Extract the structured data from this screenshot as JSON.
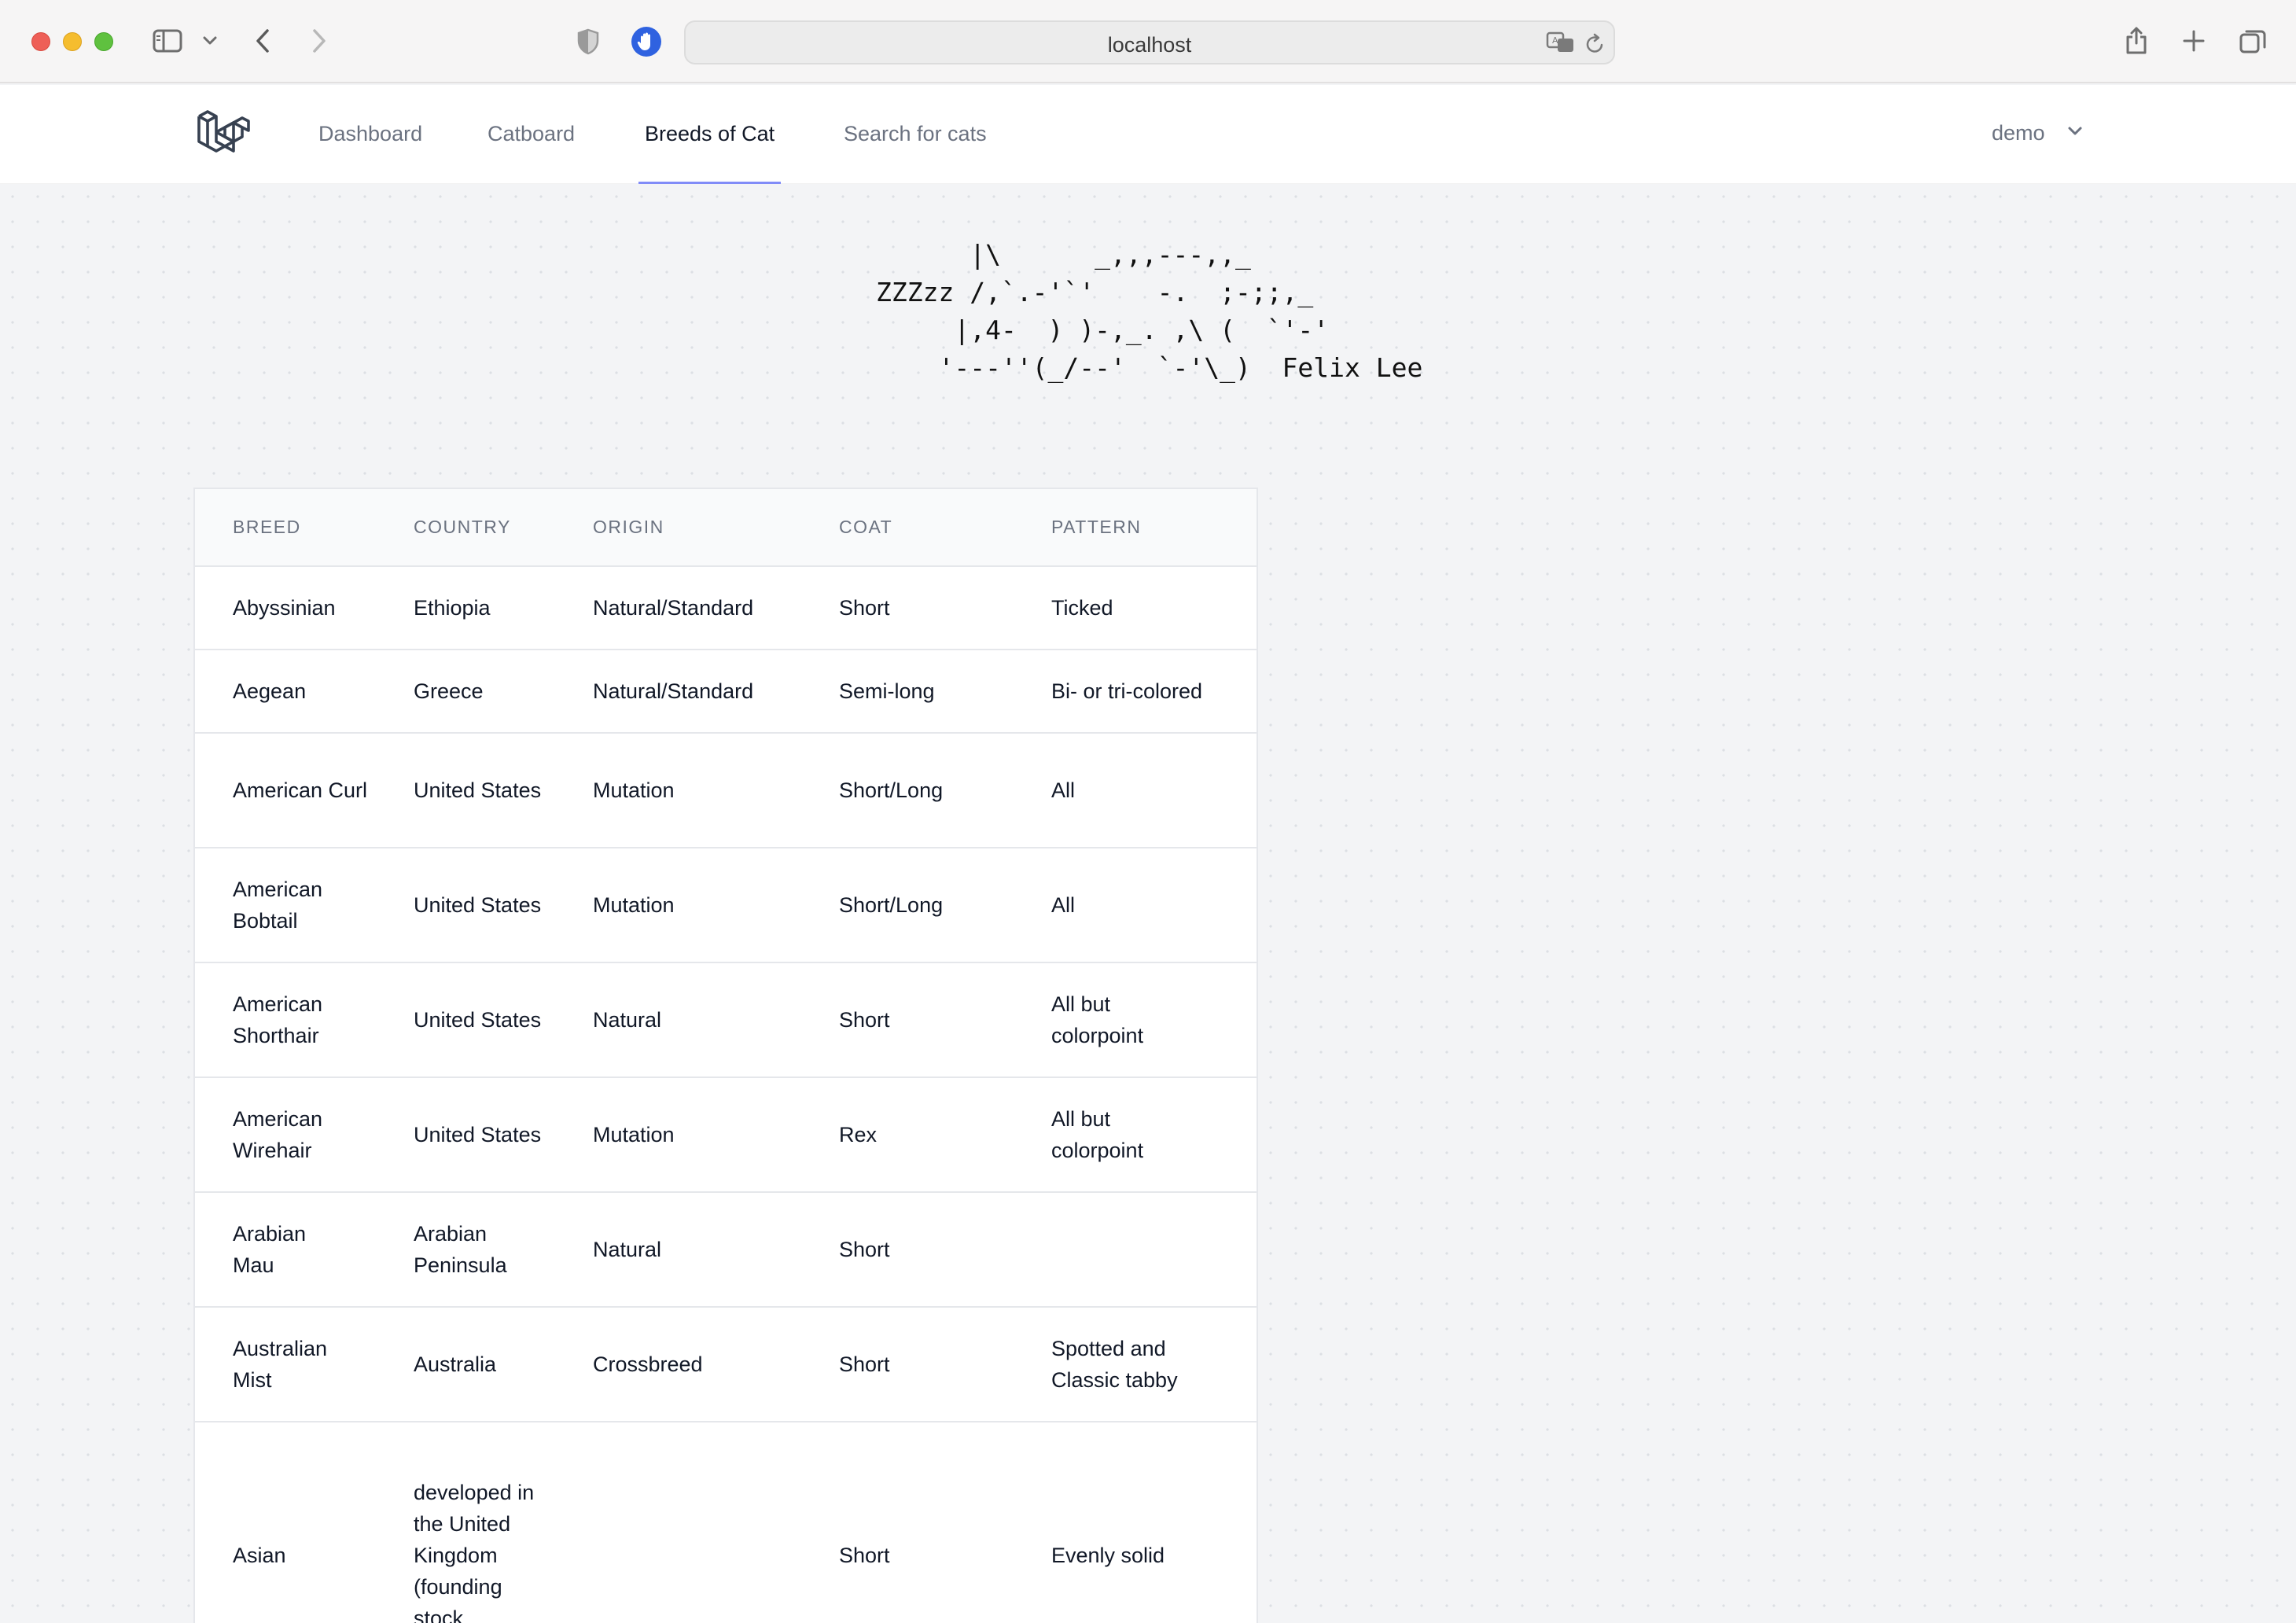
{
  "browser": {
    "url": "localhost"
  },
  "nav": {
    "links": [
      "Dashboard",
      "Catboard",
      "Breeds of Cat",
      "Search for cats"
    ],
    "active": "Breeds of Cat",
    "user": "demo",
    "accent_color": "#818cf8"
  },
  "ascii_art": {
    "lines": [
      "      |\\      _,,,---,,_",
      "ZZZzz /,`.-'`'    -.  ;-;;,_",
      "     |,4-  ) )-,_. ,\\ (  `'-'",
      "    '---''(_/--'  `-'\\_)  Felix Lee"
    ]
  },
  "table": {
    "headers": [
      "BREED",
      "COUNTRY",
      "ORIGIN",
      "COAT",
      "PATTERN"
    ],
    "rows": [
      [
        "Abyssinian",
        "Ethiopia",
        "Natural/Standard",
        "Short",
        "Ticked"
      ],
      [
        "Aegean",
        "Greece",
        "Natural/Standard",
        "Semi-long",
        "Bi- or tri-colored"
      ],
      [
        "American Curl",
        "United States",
        "Mutation",
        "Short/Long",
        "All"
      ],
      [
        "American Bobtail",
        "United States",
        "Mutation",
        "Short/Long",
        "All"
      ],
      [
        "American Shorthair",
        "United States",
        "Natural",
        "Short",
        "All but colorpoint"
      ],
      [
        "American Wirehair",
        "United States",
        "Mutation",
        "Rex",
        "All but colorpoint"
      ],
      [
        "Arabian Mau",
        "Arabian Peninsula",
        "Natural",
        "Short",
        ""
      ],
      [
        "Australian Mist",
        "Australia",
        "Crossbreed",
        "Short",
        "Spotted and Classic tabby"
      ],
      [
        "Asian",
        "developed in the United Kingdom (founding stock",
        "",
        "Short",
        "Evenly solid"
      ]
    ]
  }
}
